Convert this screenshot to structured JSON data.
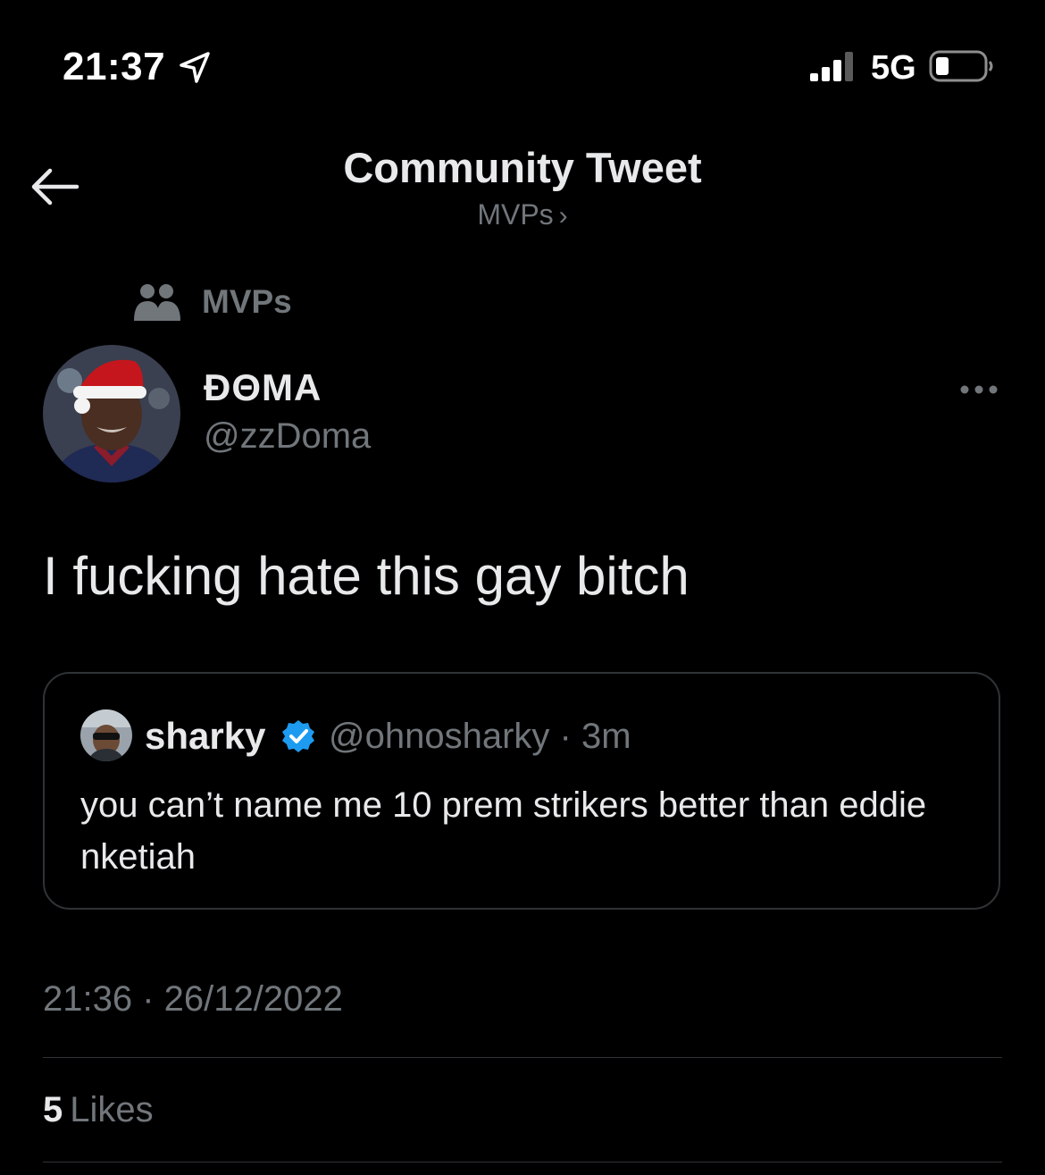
{
  "status_bar": {
    "time": "21:37",
    "network": "5G"
  },
  "header": {
    "title": "Community Tweet",
    "subtitle": "MVPs",
    "subtitle_chevron": "›"
  },
  "community": {
    "name": "MVPs"
  },
  "author": {
    "display_name": "ÐΘMA",
    "handle": "@zzDoma"
  },
  "tweet": {
    "text": "I fucking hate this gay bitch"
  },
  "quote": {
    "name": "sharky",
    "handle_time": "@ohnosharky · 3m",
    "text": "you can’t name me 10 prem strikers better than eddie nketiah"
  },
  "meta": {
    "timestamp": "21:36 · 26/12/2022",
    "likes_count": "5",
    "likes_label": "Likes"
  },
  "colors": {
    "background": "#000000",
    "text": "#e7e9ea",
    "muted": "#71767b",
    "border": "#2f3336",
    "verified": "#1d9bf0"
  }
}
